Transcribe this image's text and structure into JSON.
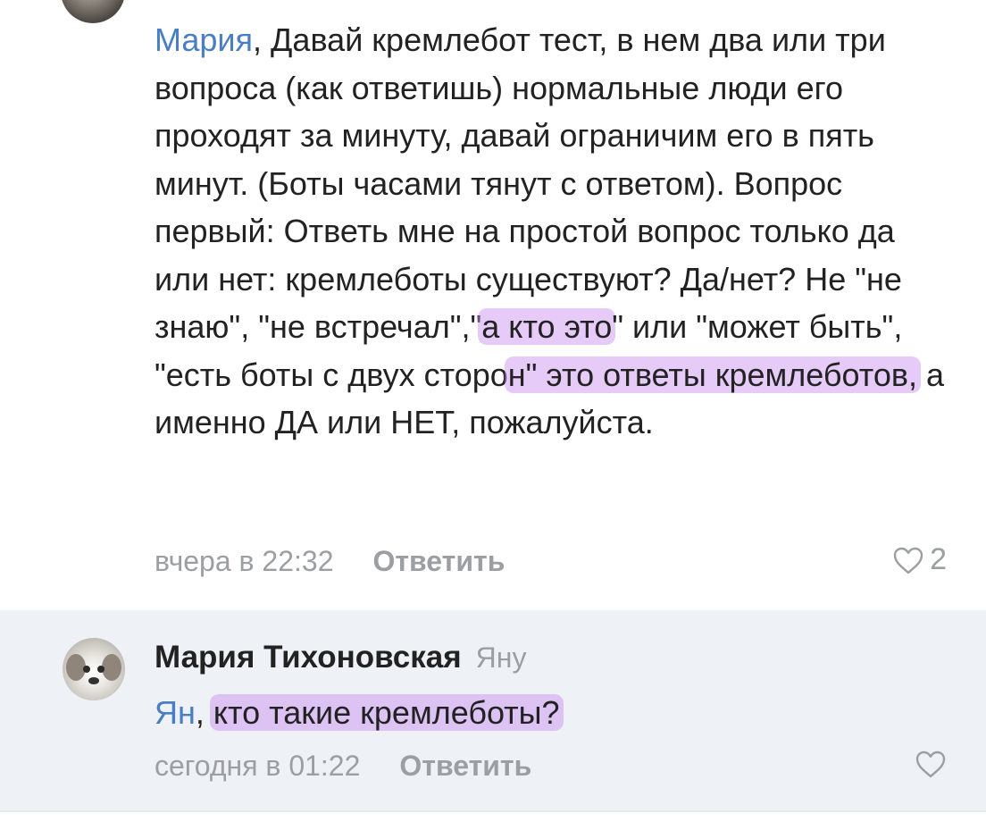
{
  "comment1": {
    "mention": "Мария",
    "text_1": ", Давай кремлебот тест, в нем два или три вопроса (как ответишь) нормальные люди его проходят за минуту, давай ограничим его в пять минут. (Боты часами тянут с ответом). Вопрос первый: Ответь мне на простой вопрос только да или нет: кремлеботы существуют? Да/нет? Не \"не знаю\", \"не встречал\",\"",
    "highlight_1": "а кто это",
    "text_2": "\" или \"может быть\", \"есть боты с двух сторо",
    "highlight_2": "н\" это ответы кремлеботов,",
    "text_3": " а именно ДА или НЕТ, пожалуйста.",
    "time": "вчера в 22:32",
    "reply_label": "Ответить",
    "likes": "2",
    "icon": "heart-outline-icon"
  },
  "comment2": {
    "author": "Мария Тихоновская",
    "to_whom": "Яну",
    "mention": "Ян",
    "text_1": ", ",
    "highlight_1": "кто такие кремлеботы?",
    "time": "сегодня в 01:22",
    "reply_label": "Ответить",
    "icon": "heart-outline-icon"
  },
  "colors": {
    "mention": "#4a7ec4",
    "highlight": "#c88cf0",
    "meta_text": "#9b9ea3",
    "reply_bg": "#eef1f6"
  }
}
